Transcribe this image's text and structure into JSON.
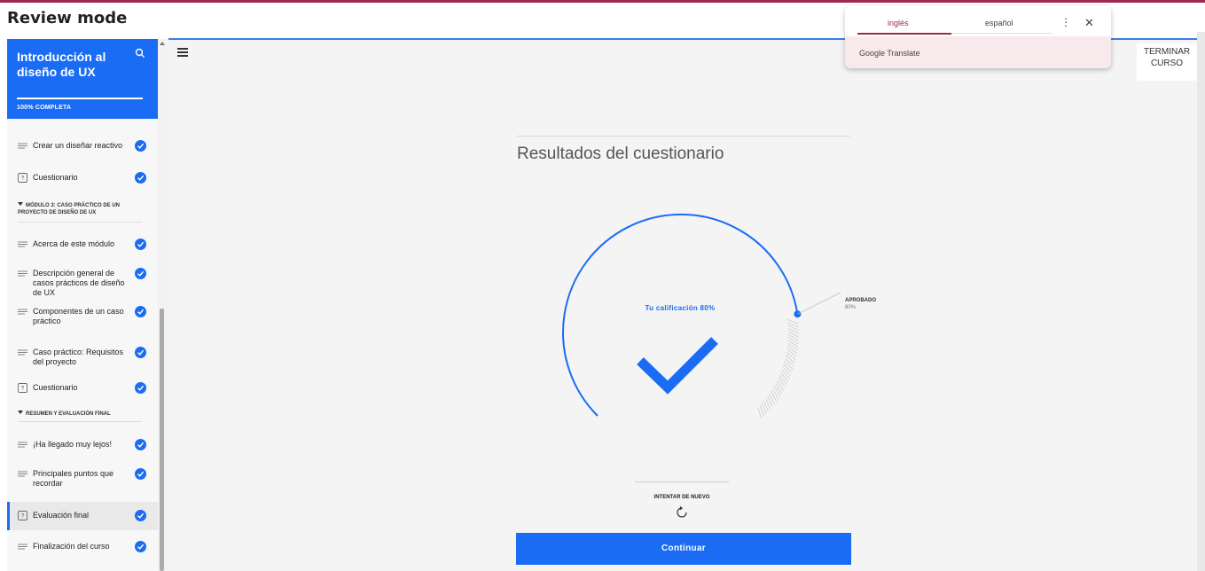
{
  "window": {
    "mode_label": "Review mode"
  },
  "sidebar": {
    "course_title": "Introducción al diseño de UX",
    "progress_label": "100% COMPLETA",
    "progress_percent": 100,
    "items": [
      {
        "label": "Crear un diseñar reactivo",
        "icon": "lines-icon",
        "completed": true
      },
      {
        "label": "Cuestionario",
        "icon": "quiz-icon",
        "completed": true
      },
      {
        "section": "MÓDULO 3: CASO PRÁCTICO DE UN PROYECTO DE DISEÑO DE UX"
      },
      {
        "label": "Acerca de este módulo",
        "icon": "lines-icon",
        "completed": true
      },
      {
        "label": "Descripción general de casos prácticos de diseño de UX",
        "icon": "lines-icon",
        "completed": true
      },
      {
        "label": "Componentes de un caso práctico",
        "icon": "lines-icon",
        "completed": true
      },
      {
        "label": "Caso práctico: Requisitos del proyecto",
        "icon": "lines-icon",
        "completed": true
      },
      {
        "label": "Cuestionario",
        "icon": "quiz-icon",
        "completed": true
      },
      {
        "section": "RESUMEN Y EVALUACIÓN FINAL"
      },
      {
        "label": "¡Ha llegado muy lejos!",
        "icon": "lines-icon",
        "completed": true
      },
      {
        "label": "Principales puntos que recordar",
        "icon": "lines-icon",
        "completed": true
      },
      {
        "label": "Evaluación final",
        "icon": "quiz-icon",
        "completed": true,
        "active": true
      },
      {
        "label": "Finalización del curso",
        "icon": "lines-icon",
        "completed": true
      }
    ]
  },
  "header": {
    "finish_label": "TERMINAR CURSO"
  },
  "results": {
    "title": "Resultados del cuestionario",
    "score_label": "Tu calificación 80%",
    "score_percent": 80,
    "pass_label": "APROBADO",
    "pass_percent_label": "80%",
    "retry_label": "INTENTAR DE NUEVO",
    "continue_label": "Continuar"
  },
  "translate": {
    "source_lang": "inglés",
    "target_lang": "español",
    "brand": "Google Translate"
  },
  "colors": {
    "accent": "#1a6cf5",
    "translate_accent": "#9c2a4a"
  }
}
